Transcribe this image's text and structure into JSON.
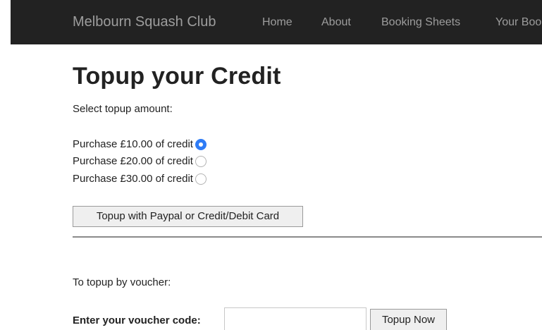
{
  "navbar": {
    "brand": "Melbourn Squash Club",
    "items": [
      "Home",
      "About",
      "Booking Sheets",
      "Your Boo"
    ]
  },
  "main": {
    "title": "Topup your Credit",
    "select_label": "Select topup amount:",
    "options": [
      {
        "label": "Purchase £10.00 of credit",
        "checked": true
      },
      {
        "label": "Purchase £20.00 of credit",
        "checked": false
      },
      {
        "label": "Purchase £30.00 of credit",
        "checked": false
      }
    ],
    "paypal_button": "Topup with Paypal or Credit/Debit Card",
    "voucher_intro": "To topup by voucher:",
    "voucher_label": "Enter your voucher code:",
    "voucher_value": "",
    "voucher_button": "Topup Now"
  },
  "colors": {
    "navbar_bg": "#222222",
    "navbar_text": "#9d9d9d",
    "radio_checked": "#2f7cf6"
  }
}
